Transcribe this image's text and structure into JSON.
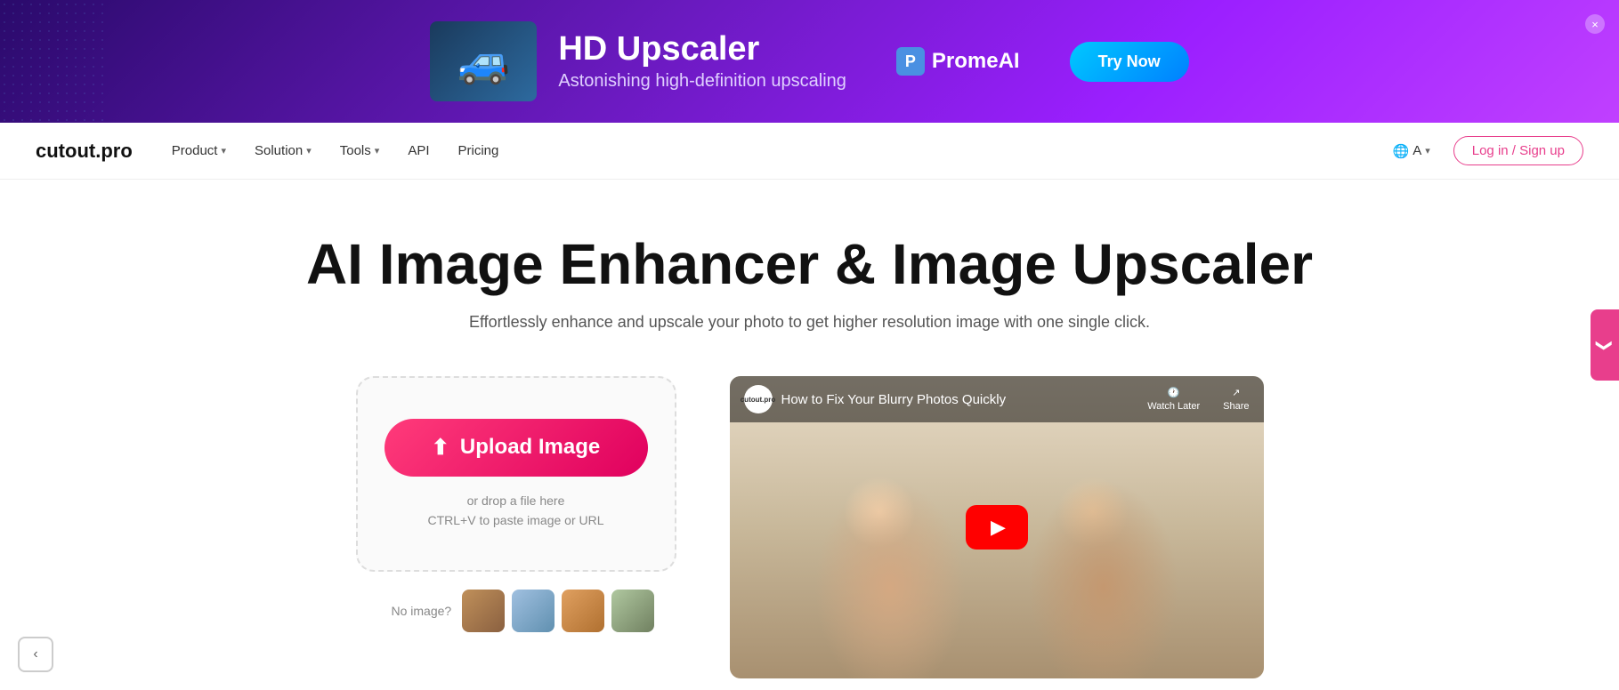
{
  "ad": {
    "title": "HD Upscaler",
    "subtitle": "Astonishing high-definition upscaling",
    "brand_name": "PromeAI",
    "try_btn": "Try Now",
    "close_label": "×"
  },
  "navbar": {
    "logo": "cutout.pro",
    "product_label": "Product",
    "solution_label": "Solution",
    "tools_label": "Tools",
    "api_label": "API",
    "pricing_label": "Pricing",
    "lang_label": "A",
    "login_label": "Log in / Sign up"
  },
  "hero": {
    "title": "AI Image Enhancer & Image Upscaler",
    "subtitle": "Effortlessly enhance and upscale your photo to get higher resolution image with one single click."
  },
  "upload": {
    "btn_label": "Upload Image",
    "hint_line1": "or drop a file here",
    "hint_line2": "CTRL+V to paste image or URL"
  },
  "video": {
    "channel": "cutout.pro",
    "title": "How to Fix Your Blurry Photos Quickly",
    "watch_later": "Watch Later",
    "share": "Share"
  },
  "samples": {
    "label": "No image?"
  }
}
